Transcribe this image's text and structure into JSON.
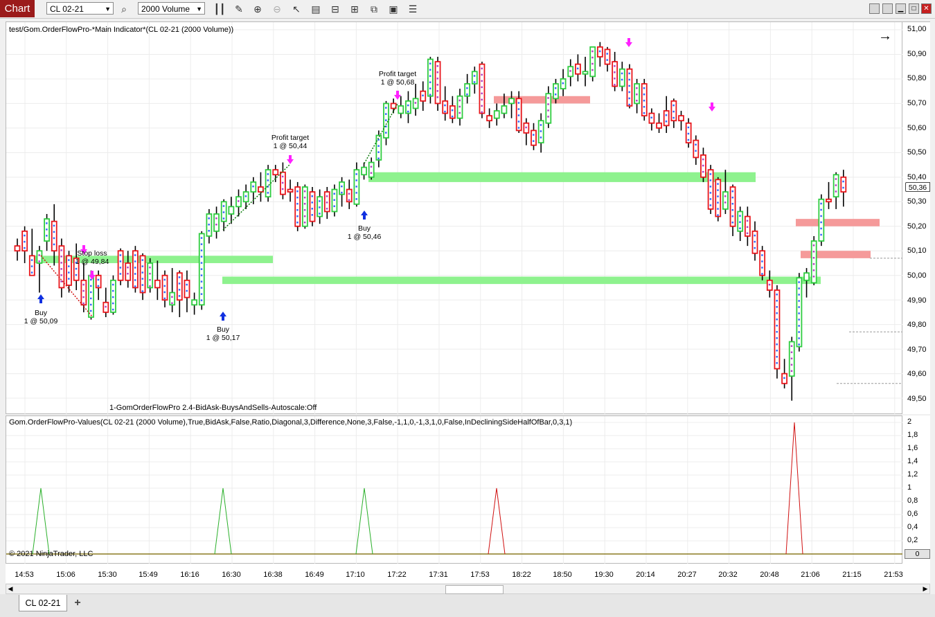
{
  "app": {
    "badge": "Chart"
  },
  "toolbar": {
    "instrument": "CL 02-21",
    "bar_type": "2000 Volume",
    "icons": [
      "search-icon",
      "bars-icon",
      "pencil-icon",
      "zoom-in-icon",
      "zoom-out-icon",
      "cursor-icon",
      "properties-icon",
      "template-icon",
      "data-box-icon",
      "strategies-icon",
      "menu-icon"
    ],
    "window_buttons": [
      "minimize-icon",
      "maximize-icon",
      "close-icon"
    ]
  },
  "main_panel": {
    "title": "test/Gom.OrderFlowPro-*Main Indicator*(CL 02-21 (2000 Volume))",
    "indicator_label": "1-GomOrderFlowPro 2.4-BidAsk-BuysAndSells-Autoscale:Off",
    "price_labels": [
      "51,00",
      "50,90",
      "50,80",
      "50,70",
      "50,60",
      "50,50",
      "50,40",
      "50,30",
      "50,20",
      "50,10",
      "50,00",
      "49,90",
      "49,80",
      "49,70",
      "49,60",
      "49,50"
    ],
    "last_price": "50,36",
    "annotations": [
      {
        "text": "Buy",
        "sub": "1 @ 50,09"
      },
      {
        "text": "Stop loss",
        "sub": "1 @ 49,84"
      },
      {
        "text": "Buy",
        "sub": "1 @ 50,17"
      },
      {
        "text": "Profit target",
        "sub": "1 @ 50,44"
      },
      {
        "text": "Buy",
        "sub": "1 @ 50,46"
      },
      {
        "text": "Profit target",
        "sub": "1 @ 50,68"
      }
    ],
    "colors": {
      "up": "#2ecc40",
      "down": "#e8151b",
      "support": "#8ef28e",
      "resistance": "#f59a9a"
    }
  },
  "indicator_panel": {
    "title": "Gom.OrderFlowPro-Values(CL 02-21 (2000 Volume),True,BidAsk,False,Ratio,Diagonal,3,Difference,None,3,False,-1,1,0,-1,3,1,0,False,InDecliningSideHalfOfBar,0,3,1)",
    "copyright": "© 2021 NinjaTrader, LLC",
    "value_labels": [
      "2",
      "1,8",
      "1,6",
      "1,4",
      "1,2",
      "1",
      "0,8",
      "0,6",
      "0,4",
      "0,2"
    ],
    "zero_label": "0"
  },
  "time_labels": [
    "14:53",
    "15:06",
    "15:30",
    "15:49",
    "16:16",
    "16:30",
    "16:38",
    "16:49",
    "17:10",
    "17:22",
    "17:31",
    "17:53",
    "18:22",
    "18:50",
    "19:30",
    "20:14",
    "20:27",
    "20:32",
    "20:48",
    "21:06",
    "21:15",
    "21:53"
  ],
  "tabs": {
    "active": "CL 02-21",
    "add": "+"
  }
}
